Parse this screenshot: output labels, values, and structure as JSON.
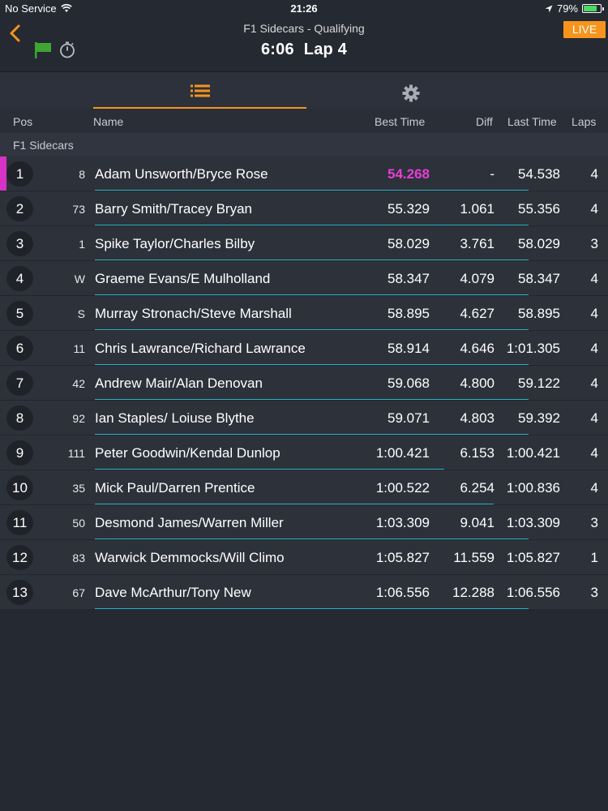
{
  "status_bar": {
    "carrier": "No Service",
    "time": "21:26",
    "battery": "79%",
    "battery_level": 0.79
  },
  "header": {
    "title": "F1 Sidecars - Qualifying",
    "clock": "6:06",
    "lap": "Lap 4",
    "live_label": "LIVE"
  },
  "columns": {
    "pos": "Pos",
    "name": "Name",
    "best": "Best Time",
    "diff": "Diff",
    "last": "Last Time",
    "laps": "Laps"
  },
  "group_label": "F1 Sidecars",
  "colors": {
    "accent": "#f7941d",
    "fastest": "#e63fd6",
    "progress": "#2ab3c6",
    "flag": "#3fa535"
  },
  "rows": [
    {
      "pos": "1",
      "num": "8",
      "name": "Adam Unsworth/Bryce Rose",
      "best": "54.268",
      "diff": "-",
      "last": "54.538",
      "laps": "4",
      "fastest": true,
      "progress": 0.87
    },
    {
      "pos": "2",
      "num": "73",
      "name": "Barry Smith/Tracey Bryan",
      "best": "55.329",
      "diff": "1.061",
      "last": "55.356",
      "laps": "4",
      "fastest": false,
      "progress": 0.87
    },
    {
      "pos": "3",
      "num": "1",
      "name": "Spike Taylor/Charles Bilby",
      "best": "58.029",
      "diff": "3.761",
      "last": "58.029",
      "laps": "3",
      "fastest": false,
      "progress": 0.87
    },
    {
      "pos": "4",
      "num": "W",
      "name": "Graeme Evans/E Mulholland",
      "best": "58.347",
      "diff": "4.079",
      "last": "58.347",
      "laps": "4",
      "fastest": false,
      "progress": 0.87
    },
    {
      "pos": "5",
      "num": "S",
      "name": "Murray Stronach/Steve Marshall",
      "best": "58.895",
      "diff": "4.627",
      "last": "58.895",
      "laps": "4",
      "fastest": false,
      "progress": 0.87
    },
    {
      "pos": "6",
      "num": "11",
      "name": "Chris Lawrance/Richard Lawrance",
      "best": "58.914",
      "diff": "4.646",
      "last": "1:01.305",
      "laps": "4",
      "fastest": false,
      "progress": 0.87
    },
    {
      "pos": "7",
      "num": "42",
      "name": "Andrew Mair/Alan Denovan",
      "best": "59.068",
      "diff": "4.800",
      "last": "59.122",
      "laps": "4",
      "fastest": false,
      "progress": 0.87
    },
    {
      "pos": "8",
      "num": "92",
      "name": "Ian Staples/ Loiuse Blythe",
      "best": "59.071",
      "diff": "4.803",
      "last": "59.392",
      "laps": "4",
      "fastest": false,
      "progress": 0.87
    },
    {
      "pos": "9",
      "num": "111",
      "name": "Peter Goodwin/Kendal Dunlop",
      "best": "1:00.421",
      "diff": "6.153",
      "last": "1:00.421",
      "laps": "4",
      "fastest": false,
      "progress": 0.7
    },
    {
      "pos": "10",
      "num": "35",
      "name": "Mick Paul/Darren Prentice",
      "best": "1:00.522",
      "diff": "6.254",
      "last": "1:00.836",
      "laps": "4",
      "fastest": false,
      "progress": 0.8
    },
    {
      "pos": "11",
      "num": "50",
      "name": "Desmond James/Warren Miller",
      "best": "1:03.309",
      "diff": "9.041",
      "last": "1:03.309",
      "laps": "3",
      "fastest": false,
      "progress": 0.87
    },
    {
      "pos": "12",
      "num": "83",
      "name": "Warwick Demmocks/Will Climo",
      "best": "1:05.827",
      "diff": "11.559",
      "last": "1:05.827",
      "laps": "1",
      "fastest": false,
      "progress": 0
    },
    {
      "pos": "13",
      "num": "67",
      "name": "Dave McArthur/Tony New",
      "best": "1:06.556",
      "diff": "12.288",
      "last": "1:06.556",
      "laps": "3",
      "fastest": false,
      "progress": 0.87
    }
  ]
}
